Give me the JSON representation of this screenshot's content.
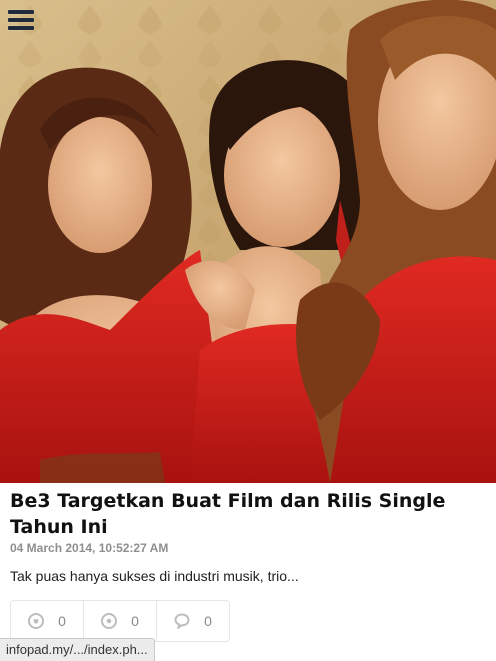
{
  "header": {
    "menu_icon": "hamburger-menu-icon"
  },
  "article": {
    "title": "Be3 Targetkan Buat Film dan Rilis Single Tahun Ini",
    "date": "04 March 2014, 10:52:27 AM",
    "excerpt": "Tak puas hanya sukses di industri musik, trio..."
  },
  "stats": {
    "likes": {
      "icon": "heart-icon",
      "count": "0"
    },
    "views": {
      "icon": "eye-icon",
      "count": "0"
    },
    "comments": {
      "icon": "comment-bubble-icon",
      "count": "0"
    }
  },
  "status_bar": {
    "url": "infopad.my/.../index.ph..."
  },
  "colors": {
    "background": "#ffffff",
    "title": "#111111",
    "meta": "#8e8e8e",
    "dress_red": "#d01a1a",
    "wallpaper_gold": "#c9ab79"
  }
}
